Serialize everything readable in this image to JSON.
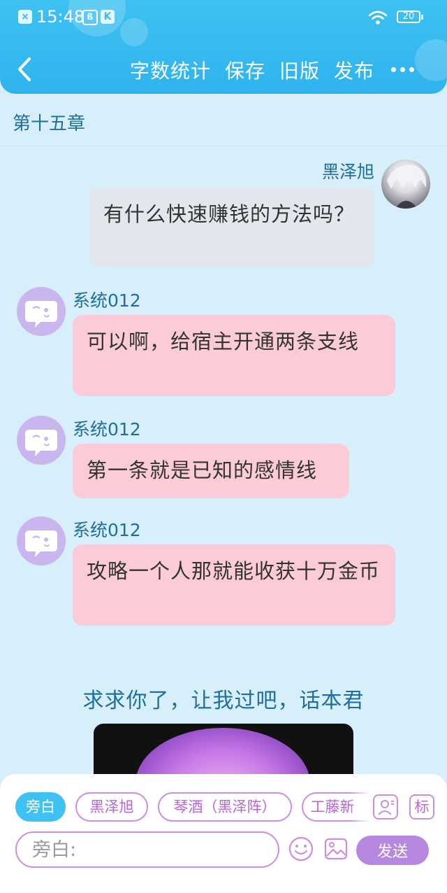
{
  "status_bar": {
    "time": "15:48",
    "battery": "20",
    "icons": [
      "close-app-icon",
      "shopping-icon",
      "k-app-icon",
      "wifi-icon",
      "battery-icon"
    ]
  },
  "toolbar": {
    "word_count": "字数统计",
    "save": "保存",
    "old_version": "旧版",
    "publish": "发布"
  },
  "chapter_title": "第十五章",
  "messages": [
    {
      "sender": "黑泽旭",
      "text": "有什么快速赚钱的方法吗？",
      "side": "right"
    },
    {
      "sender": "系统012",
      "text": "可以啊，给宿主开通两条支线",
      "side": "left"
    },
    {
      "sender": "系统012",
      "text": "第一条就是已知的感情线",
      "side": "left"
    },
    {
      "sender": "系统012",
      "text": "攻略一个人那就能收获十万金币",
      "side": "left"
    }
  ],
  "narration": "求求你了，让我过吧，话本君",
  "role_tabs": [
    {
      "label": "旁白",
      "active": true
    },
    {
      "label": "黑泽旭",
      "active": false
    },
    {
      "label": "琴酒（黑泽阵）",
      "active": false
    },
    {
      "label": "工藤新",
      "active": false
    }
  ],
  "side_icon_label": "标",
  "input": {
    "placeholder": "旁白:"
  },
  "send_label": "发送",
  "colors": {
    "header": "#3ec2f2",
    "background": "#d6effa",
    "user_bubble": "#e1e7ec",
    "system_bubble": "#fbccd8",
    "accent_purple": "#b788e0",
    "text_blue": "#1f6f9e"
  }
}
